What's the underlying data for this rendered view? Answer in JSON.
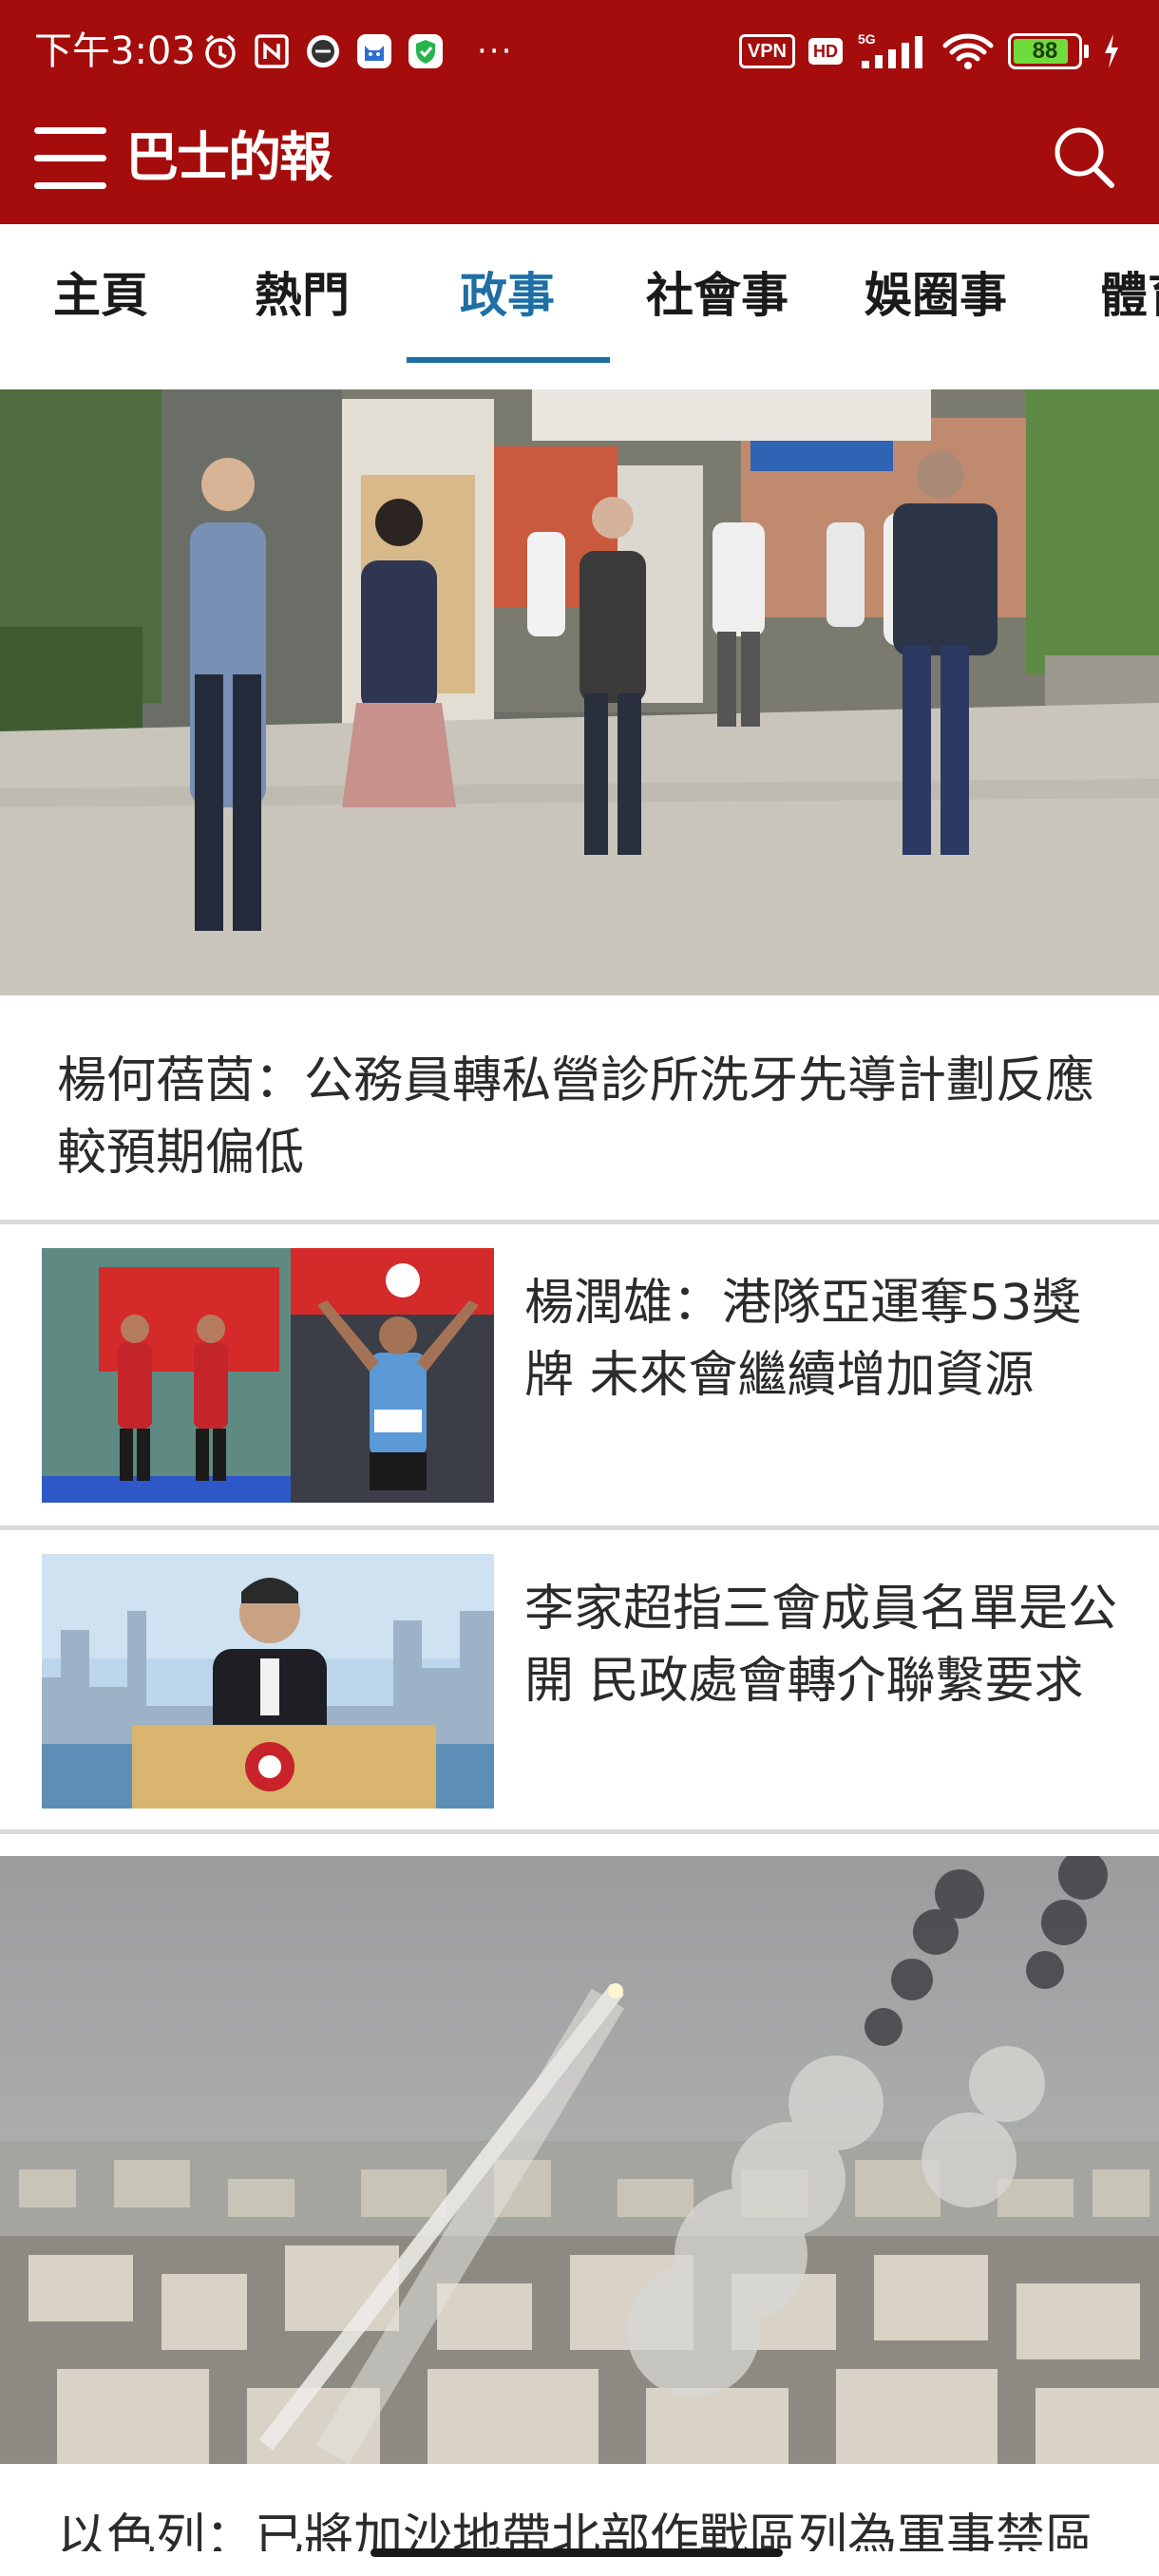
{
  "status_bar": {
    "time": "下午3:03",
    "vpn": "VPN",
    "hd": "HD",
    "network": "5G",
    "battery": "88",
    "battery_level": 0.88,
    "more": "···"
  },
  "app_bar": {
    "logo": "巴士的報",
    "brand_color": "#a50d0d",
    "menu_icon": "hamburger-menu-icon",
    "search_icon": "search-icon"
  },
  "tabs": {
    "items": [
      "主頁",
      "熱門",
      "政事",
      "社會事",
      "娛圈事",
      "體育"
    ],
    "active_index": 2,
    "active_color": "#1d6fa5"
  },
  "articles": [
    {
      "title": "楊何蓓茵：公務員轉私營診所洗牙先導計劃反應較預期偏低",
      "layout": "hero"
    },
    {
      "title": "楊潤雄：港隊亞運奪53獎牌 未來會繼續增加資源",
      "layout": "thumbnail"
    },
    {
      "title": "李家超指三會成員名單是公開 民政處會轉介聯繫要求",
      "layout": "thumbnail"
    },
    {
      "title": "以色列：已將加沙地帶北部作戰區列為軍事禁區",
      "layout": "hero"
    }
  ]
}
